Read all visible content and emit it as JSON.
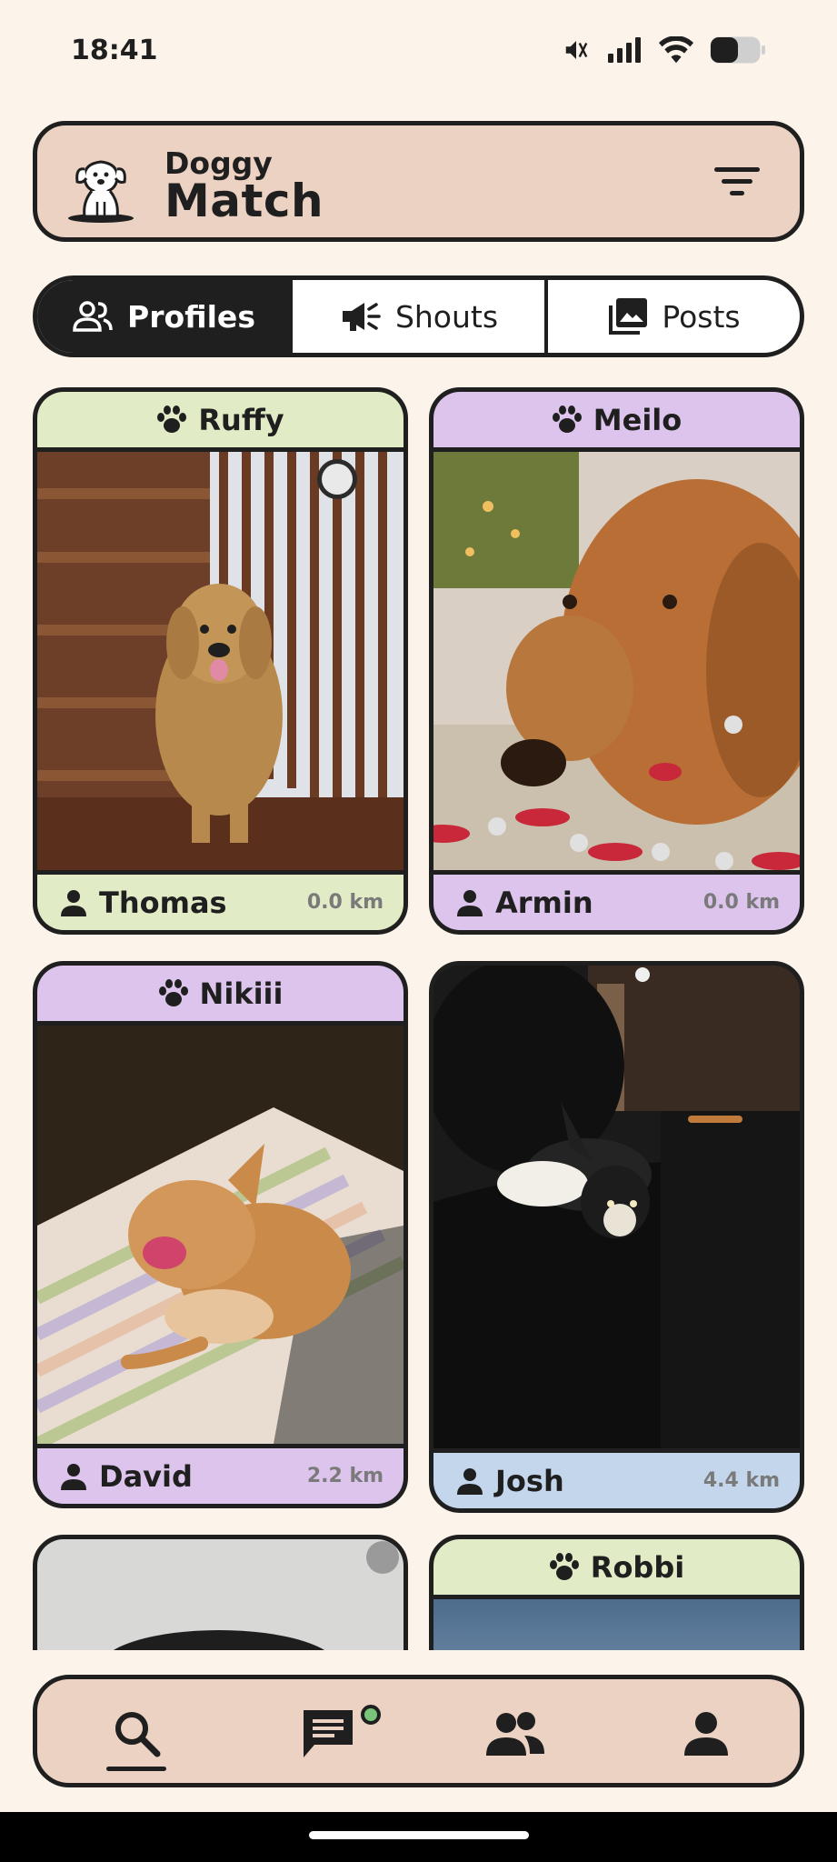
{
  "status": {
    "time": "18:41"
  },
  "header": {
    "brand_top": "Doggy",
    "brand_main": "Match"
  },
  "tabs": [
    {
      "label": "Profiles",
      "active": true
    },
    {
      "label": "Shouts",
      "active": false
    },
    {
      "label": "Posts",
      "active": false
    }
  ],
  "profiles": [
    {
      "dog": "Ruffy",
      "owner": "Thomas",
      "distance": "0.0 km",
      "color": "#e1ebc6"
    },
    {
      "dog": "Meilo",
      "owner": "Armin",
      "distance": "0.0 km",
      "color": "#dcc4ec"
    },
    {
      "dog": "Nikiii",
      "owner": "David",
      "distance": "2.2 km",
      "color": "#dcc4ec"
    },
    {
      "dog": "",
      "owner": "Josh",
      "distance": "4.4 km",
      "color": "#c4d6ec"
    },
    {
      "dog": "",
      "owner": "",
      "distance": "",
      "color": ""
    },
    {
      "dog": "Robbi",
      "owner": "",
      "distance": "",
      "color": "#e1ebc6"
    }
  ],
  "nav": {
    "items": [
      "search-icon",
      "chat-icon",
      "people-icon",
      "person-icon"
    ],
    "active": "search",
    "chat_has_notification": true
  }
}
